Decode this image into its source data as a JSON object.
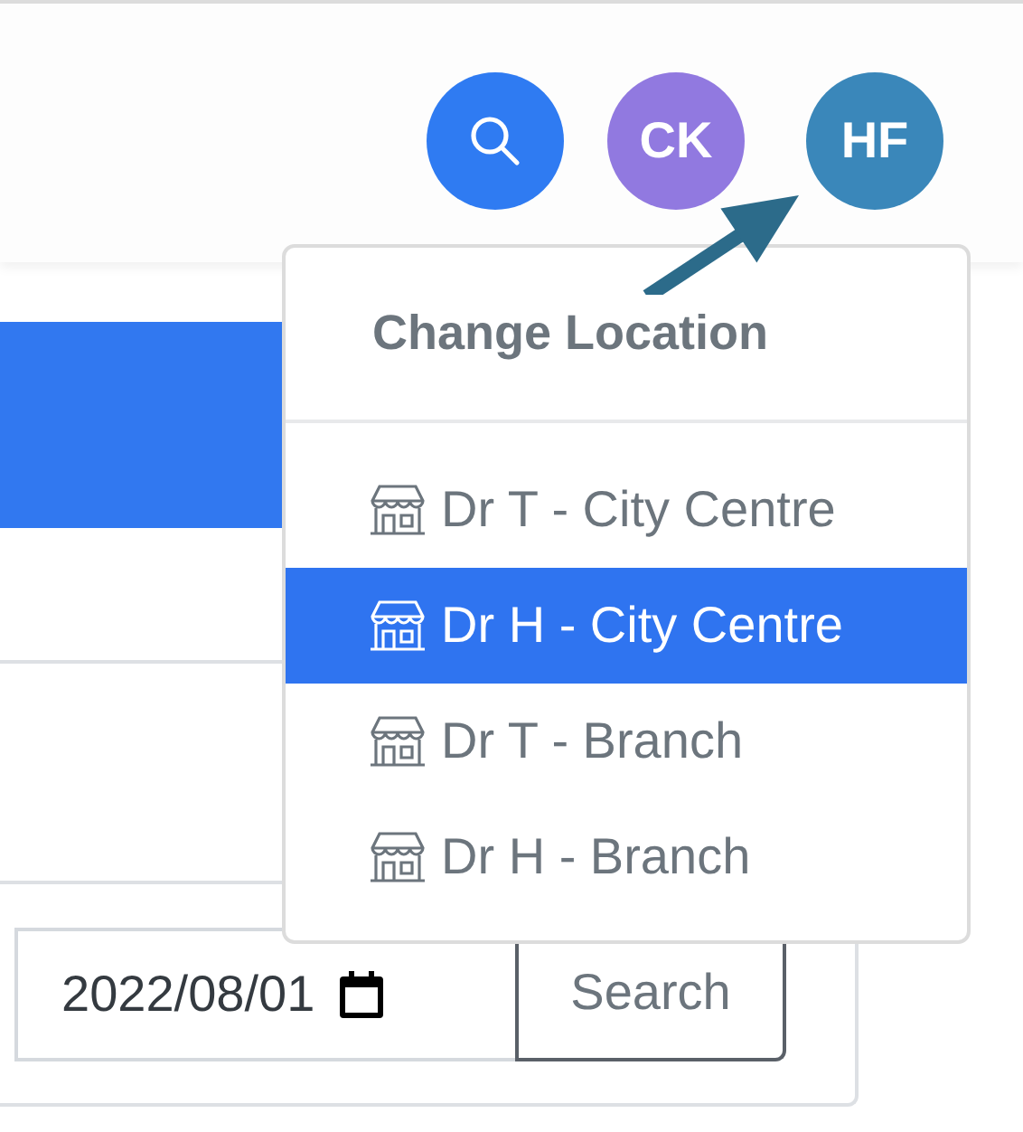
{
  "header": {
    "avatars": [
      {
        "initials": "CK",
        "color": "#9179e0"
      },
      {
        "initials": "HF",
        "color": "#3a87ba"
      }
    ]
  },
  "filter": {
    "date": "2022/08/01",
    "button": "Search"
  },
  "location_menu": {
    "title": "Change Location",
    "items": [
      {
        "label": "Dr T - City Centre",
        "selected": false
      },
      {
        "label": "Dr H - City Centre",
        "selected": true
      },
      {
        "label": "Dr T - Branch",
        "selected": false
      },
      {
        "label": "Dr H - Branch",
        "selected": false
      }
    ]
  }
}
